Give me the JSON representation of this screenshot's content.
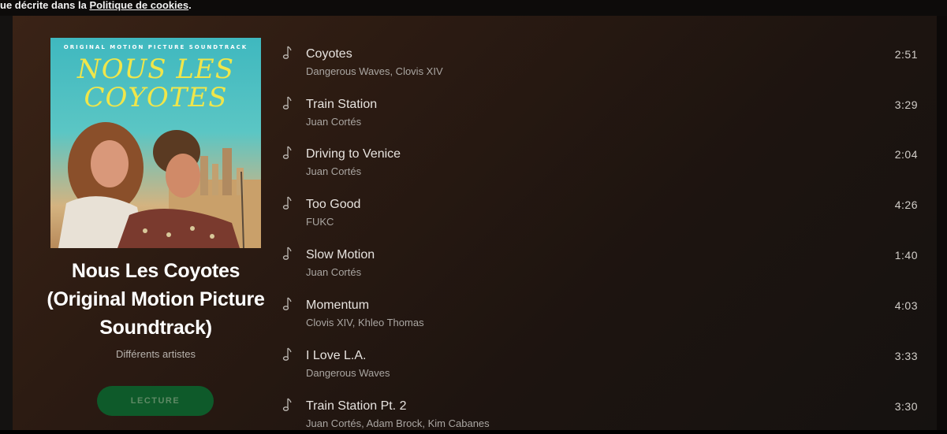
{
  "cookie_notice": {
    "text_prefix": "ue décrite dans la ",
    "link": "Politique de cookies",
    "text_suffix": "."
  },
  "album": {
    "cover_subtitle": "ORIGINAL MOTION PICTURE SOUNDTRACK",
    "cover_title_line1": "Nous les",
    "cover_title_line2": "Coyotes",
    "title": "Nous Les Coyotes (Original Motion Picture Soundtrack)",
    "artist": "Différents artistes",
    "play_label": "LECTURE"
  },
  "tracks": [
    {
      "name": "Coyotes",
      "artists": "Dangerous Waves, Clovis XIV",
      "duration": "2:51",
      "icon": "music-note-icon"
    },
    {
      "name": "Train Station",
      "artists": "Juan Cortés",
      "duration": "3:29",
      "icon": "music-note-icon"
    },
    {
      "name": "Driving to Venice",
      "artists": "Juan Cortés",
      "duration": "2:04",
      "icon": "music-note-icon"
    },
    {
      "name": "Too Good",
      "artists": "FUKC",
      "duration": "4:26",
      "icon": "music-note-icon"
    },
    {
      "name": "Slow Motion",
      "artists": "Juan Cortés",
      "duration": "1:40",
      "icon": "music-note-icon"
    },
    {
      "name": "Momentum",
      "artists": "Clovis XIV, Khleo Thomas",
      "duration": "4:03",
      "icon": "music-note-icon"
    },
    {
      "name": "I Love L.A.",
      "artists": "Dangerous Waves",
      "duration": "3:33",
      "icon": "music-note-icon"
    },
    {
      "name": "Train Station Pt. 2",
      "artists": "Juan Cortés, Adam Brock, Kim Cabanes",
      "duration": "3:30",
      "icon": "music-note-icon"
    }
  ],
  "colors": {
    "play_button": "#0e5a2a",
    "panel_background": "#2c1b12"
  }
}
